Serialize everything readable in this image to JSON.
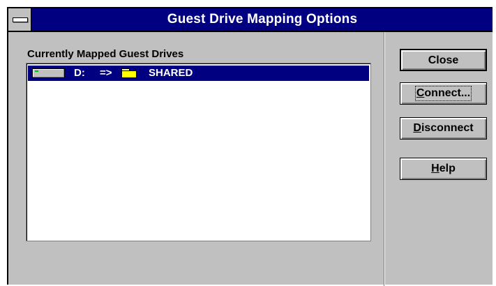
{
  "window": {
    "title": "Guest Drive Mapping Options"
  },
  "list": {
    "label": "Currently Mapped Guest Drives",
    "items": [
      {
        "drive": "D:",
        "arrow": "=>",
        "icon": "folder-icon",
        "share": "SHARED",
        "selected": true
      }
    ]
  },
  "buttons": {
    "close": {
      "label": "Close"
    },
    "connect": {
      "label": "Connect...",
      "mnemonic": "C",
      "rest": "onnect..."
    },
    "disconnect": {
      "label": "Disconnect",
      "mnemonic": "D",
      "rest": "isconnect"
    },
    "help": {
      "label": "Help",
      "mnemonic": "H",
      "rest": "elp"
    }
  },
  "colors": {
    "title_bar": "#000080",
    "face": "#c0c0c0",
    "selection": "#000080"
  }
}
